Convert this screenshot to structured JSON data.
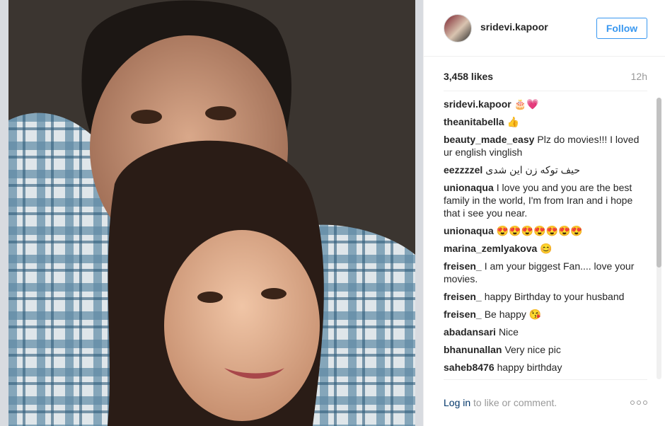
{
  "post": {
    "image_alt": "photo of a man and a woman"
  },
  "header": {
    "username": "sridevi.kapoor",
    "follow_label": "Follow"
  },
  "stats": {
    "likes": "3,458 likes",
    "time": "12h"
  },
  "comments": [
    {
      "user": "sridevi.kapoor",
      "text": "🎂💗"
    },
    {
      "user": "theanitabella",
      "text": "👍"
    },
    {
      "user": "beauty_made_easy",
      "text": "Plz do movies!!! I loved ur english vinglish"
    },
    {
      "user": "eezzzzel",
      "text": "حیف توکه زن این شدی"
    },
    {
      "user": "unionaqua",
      "text": "I love you and you are the best family in the world, I'm from Iran and i hope that i see you near."
    },
    {
      "user": "unionaqua",
      "text": "😍😍😍😍😍😍😍"
    },
    {
      "user": "marina_zemlyakova",
      "text": "😊"
    },
    {
      "user": "freisen_",
      "text": "I am your biggest Fan.... love your movies."
    },
    {
      "user": "freisen_",
      "text": "happy Birthday to your husband"
    },
    {
      "user": "freisen_",
      "text": "Be happy 😘"
    },
    {
      "user": "abadansari",
      "text": "Nice"
    },
    {
      "user": "bhanunallan",
      "text": "Very nice pic"
    },
    {
      "user": "saheb8476",
      "text": "happy birthday"
    }
  ],
  "footer": {
    "login_link": "Log in",
    "login_rest": " to like or comment."
  },
  "colors": {
    "accent": "#3897f0",
    "link": "#003569",
    "muted": "#999999"
  },
  "icons": {
    "more": "more-options-icon"
  }
}
